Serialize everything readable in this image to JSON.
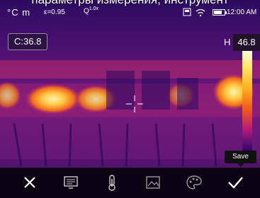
{
  "caption": "параметры измерения, инструмент",
  "status": {
    "units": "°C m",
    "emissivity": "ε=0.95",
    "zoom_label": "Q",
    "zoom_value": "1.0x",
    "time": "12:00 AM",
    "battery_level": 0.75
  },
  "measurement": {
    "center_label": "C:36.8",
    "high_marker": "H",
    "high_value": "46.8"
  },
  "tooltip": {
    "save": "Save"
  },
  "toolbar": {
    "buttons": [
      {
        "icon": "close-icon"
      },
      {
        "icon": "monitor-icon"
      },
      {
        "icon": "thermometer-icon"
      },
      {
        "icon": "image-icon"
      },
      {
        "icon": "palette-icon"
      },
      {
        "icon": "checkmark-icon"
      }
    ]
  },
  "colors": {
    "palette_hot": "#ffe76a",
    "palette_mid": "#f05a1a",
    "palette_cold": "#2a0a5e"
  }
}
